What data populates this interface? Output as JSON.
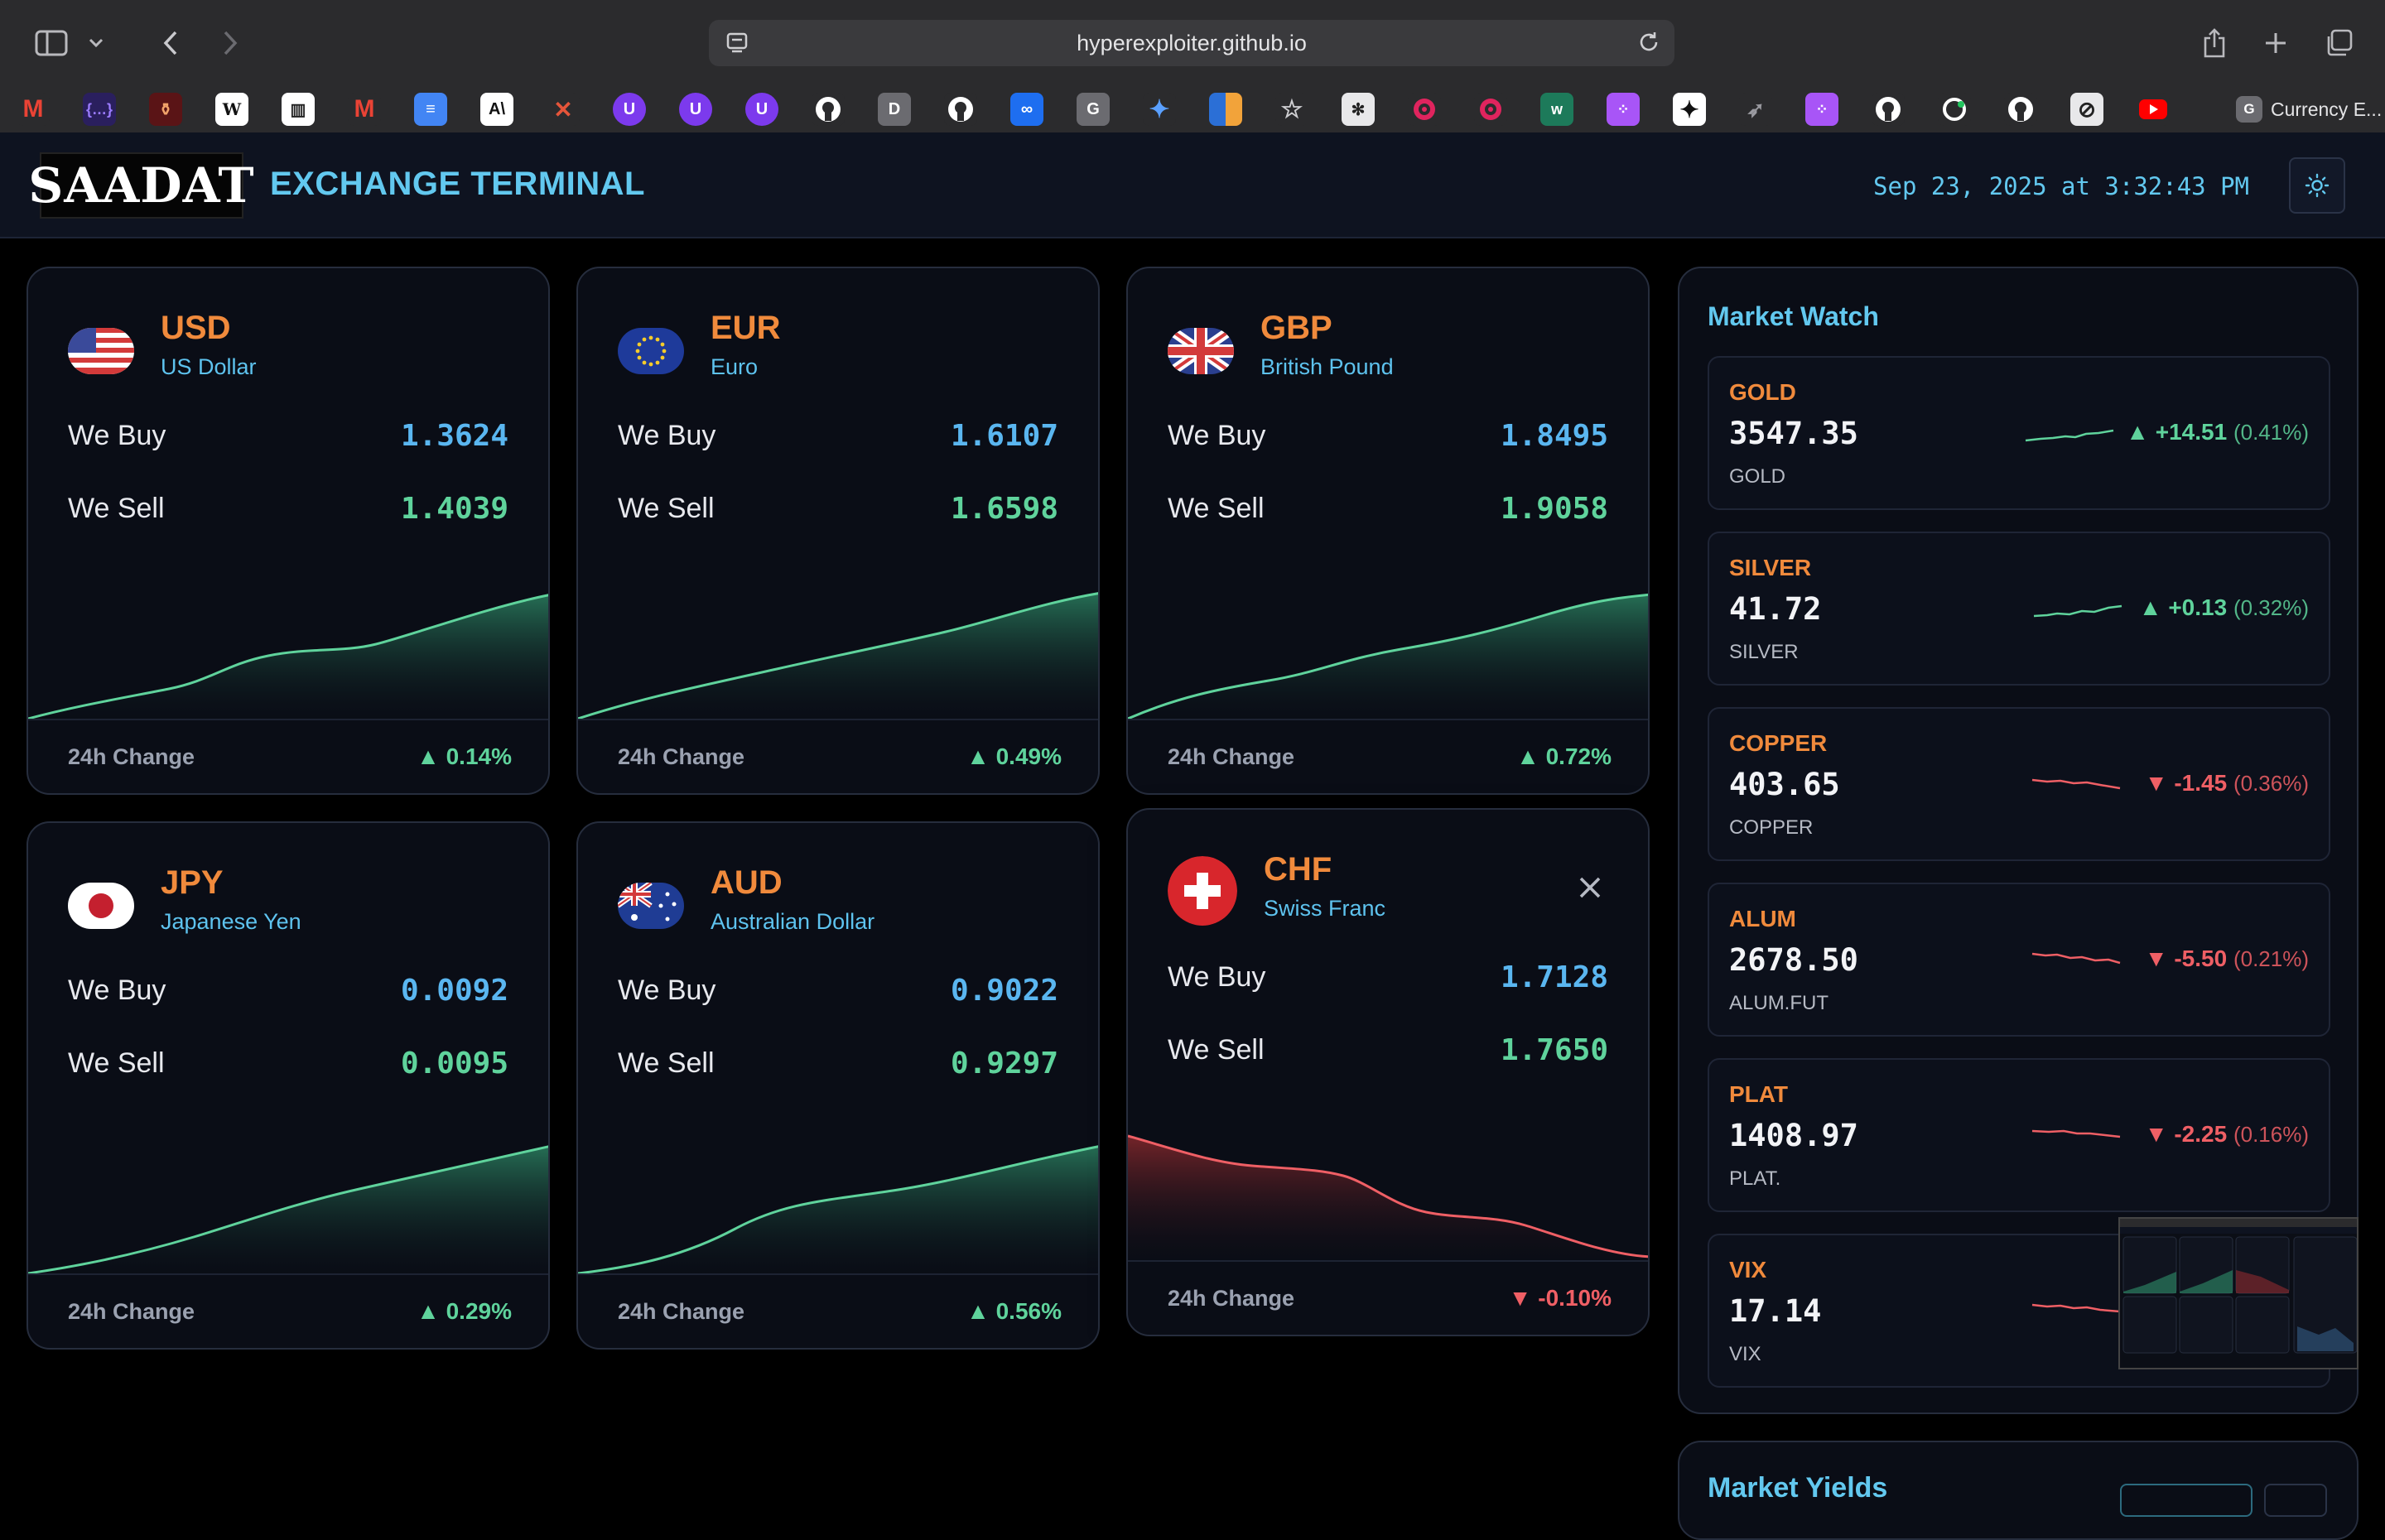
{
  "browser": {
    "url": "hyperexploiter.github.io",
    "bookmark_last_label": "Currency E..."
  },
  "header": {
    "logo": "SAADAT",
    "title": "EXCHANGE TERMINAL",
    "datetime": "Sep 23, 2025 at 3:32:43 PM"
  },
  "labels": {
    "buy": "We Buy",
    "sell": "We Sell",
    "change": "24h Change"
  },
  "currencies": [
    {
      "code": "USD",
      "name": "US Dollar",
      "buy": "1.3624",
      "sell": "1.4039",
      "change": "▲ 0.14%",
      "direction": "up"
    },
    {
      "code": "EUR",
      "name": "Euro",
      "buy": "1.6107",
      "sell": "1.6598",
      "change": "▲ 0.49%",
      "direction": "up"
    },
    {
      "code": "GBP",
      "name": "British Pound",
      "buy": "1.8495",
      "sell": "1.9058",
      "change": "▲ 0.72%",
      "direction": "up"
    },
    {
      "code": "JPY",
      "name": "Japanese Yen",
      "buy": "0.0092",
      "sell": "0.0095",
      "change": "▲ 0.29%",
      "direction": "up"
    },
    {
      "code": "AUD",
      "name": "Australian Dollar",
      "buy": "0.9022",
      "sell": "0.9297",
      "change": "▲ 0.56%",
      "direction": "up"
    },
    {
      "code": "CHF",
      "name": "Swiss Franc",
      "buy": "1.7128",
      "sell": "1.7650",
      "change": "▼ -0.10%",
      "direction": "down"
    }
  ],
  "market_watch": {
    "title": "Market Watch",
    "items": [
      {
        "symbol": "GOLD",
        "price": "3547.35",
        "sub": "GOLD",
        "change": "▲ +14.51",
        "pct": "(0.41%)",
        "direction": "up"
      },
      {
        "symbol": "SILVER",
        "price": "41.72",
        "sub": "SILVER",
        "change": "▲ +0.13",
        "pct": "(0.32%)",
        "direction": "up"
      },
      {
        "symbol": "COPPER",
        "price": "403.65",
        "sub": "COPPER",
        "change": "▼ -1.45",
        "pct": "(0.36%)",
        "direction": "down"
      },
      {
        "symbol": "ALUM",
        "price": "2678.50",
        "sub": "ALUM.FUT",
        "change": "▼ -5.50",
        "pct": "(0.21%)",
        "direction": "down"
      },
      {
        "symbol": "PLAT",
        "price": "1408.97",
        "sub": "PLAT.",
        "change": "▼ -2.25",
        "pct": "(0.16%)",
        "direction": "down"
      },
      {
        "symbol": "VIX",
        "price": "17.14",
        "sub": "VIX",
        "change": "",
        "pct": "",
        "direction": "down"
      }
    ]
  },
  "market_yields": {
    "title": "Market Yields"
  },
  "colors": {
    "accent": "#62c8ef",
    "code": "#f08a3c",
    "buy": "#5ab6f0",
    "up": "#5fd39c",
    "down": "#ef5f65",
    "card_bg": "#0a0d16"
  }
}
